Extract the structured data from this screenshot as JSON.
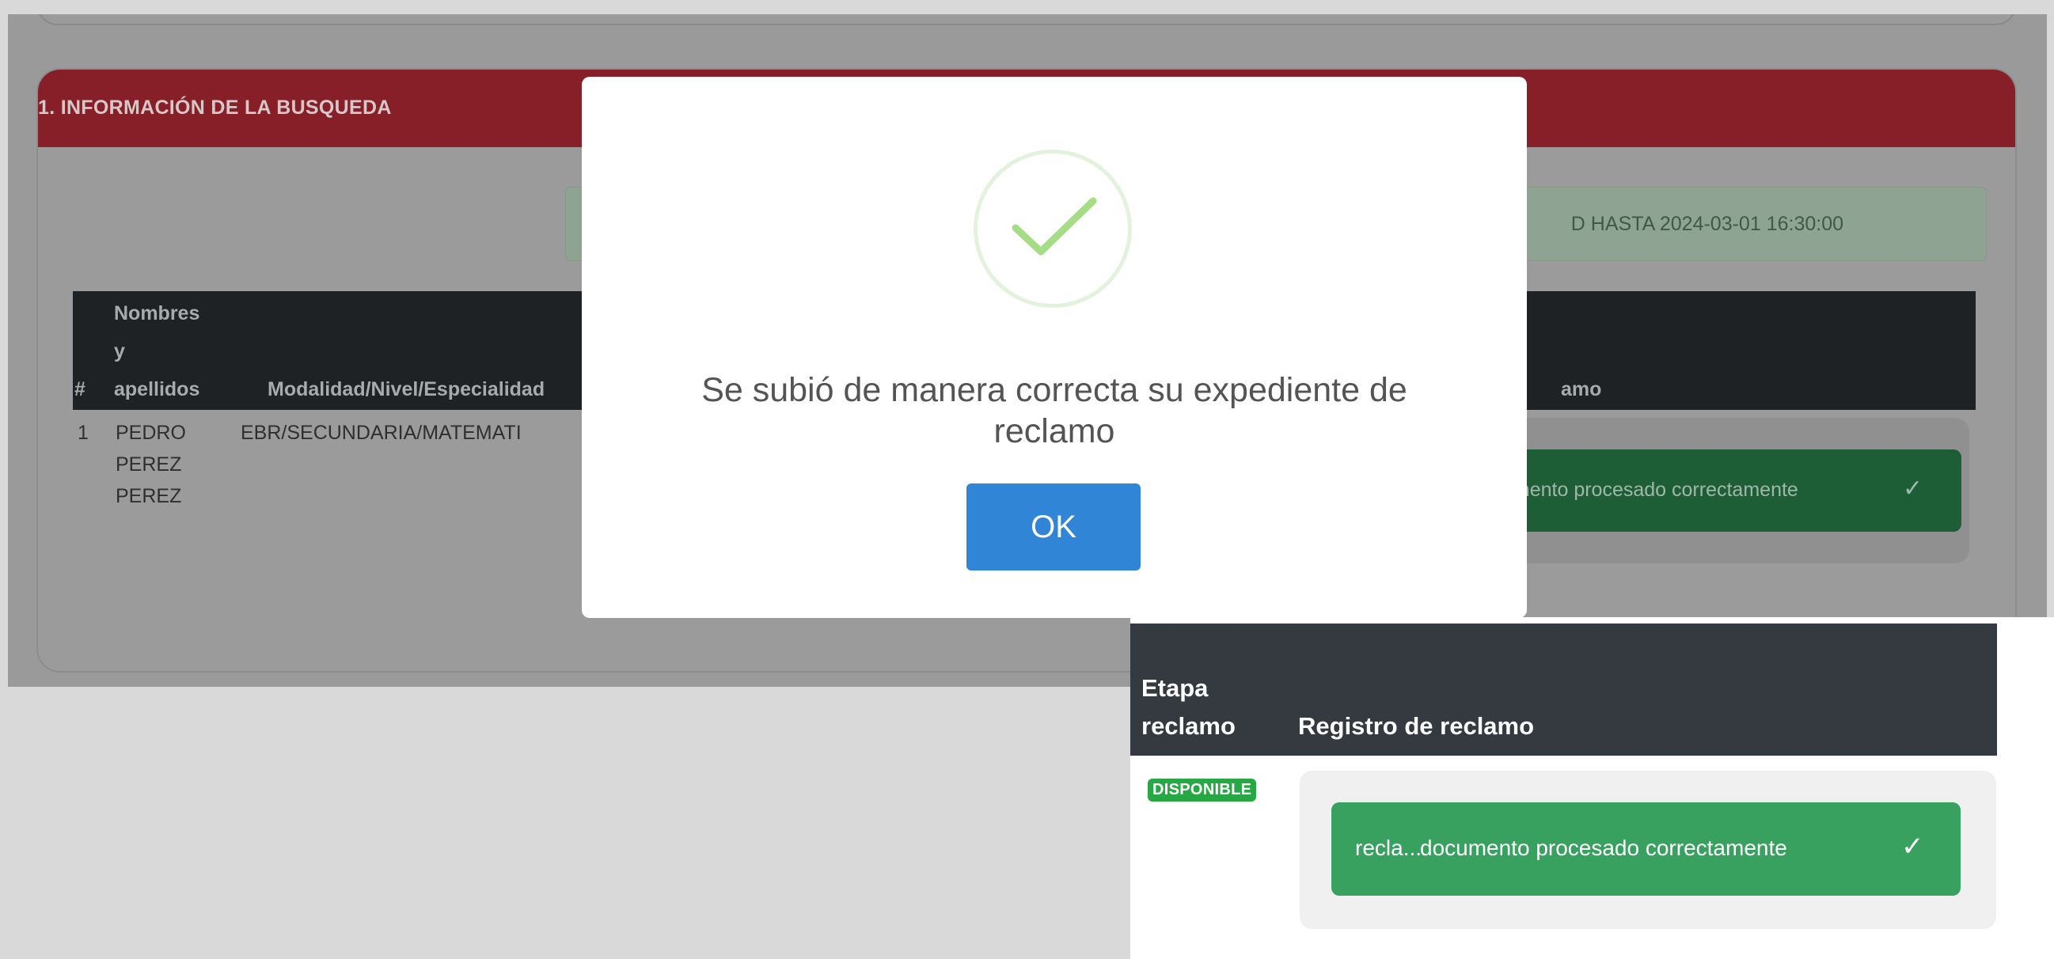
{
  "search_card": {
    "title": "1. INFORMACIÓN DE LA BUSQUEDA",
    "notice_visible": "D HASTA 2024-03-01 16:30:00"
  },
  "table": {
    "headers": {
      "index": "#",
      "names_line1": "Nombres",
      "names_line2": "y",
      "names_line3": "apellidos",
      "modality": "Modalidad/Nivel/Especialidad",
      "claim_visible": "amo"
    },
    "rows": [
      {
        "index": "1",
        "name_line1": "PEDRO",
        "name_line2": "PEREZ",
        "name_line3": "PEREZ",
        "modality": "EBR/SECUNDARIA/MATEMATI",
        "status_visible": "umento procesado correctamente",
        "status_icon": "check-icon"
      }
    ]
  },
  "modal": {
    "icon": "success-check-icon",
    "message": "Se subió de manera correcta su expediente de reclamo",
    "ok_label": "OK"
  },
  "inset": {
    "header_stage_line1": "Etapa",
    "header_stage_line2": "reclamo",
    "header_register": "Registro de reclamo",
    "badge": "DISPONIBLE",
    "file_name": "recla...",
    "status_text": "documento procesado correctamente",
    "status_icon": "check-icon"
  },
  "colors": {
    "header_red": "#861f28",
    "ok_blue": "#3085d6",
    "success_green": "#38a160",
    "badge_green": "#28a745",
    "table_head_dark": "#343a40"
  }
}
